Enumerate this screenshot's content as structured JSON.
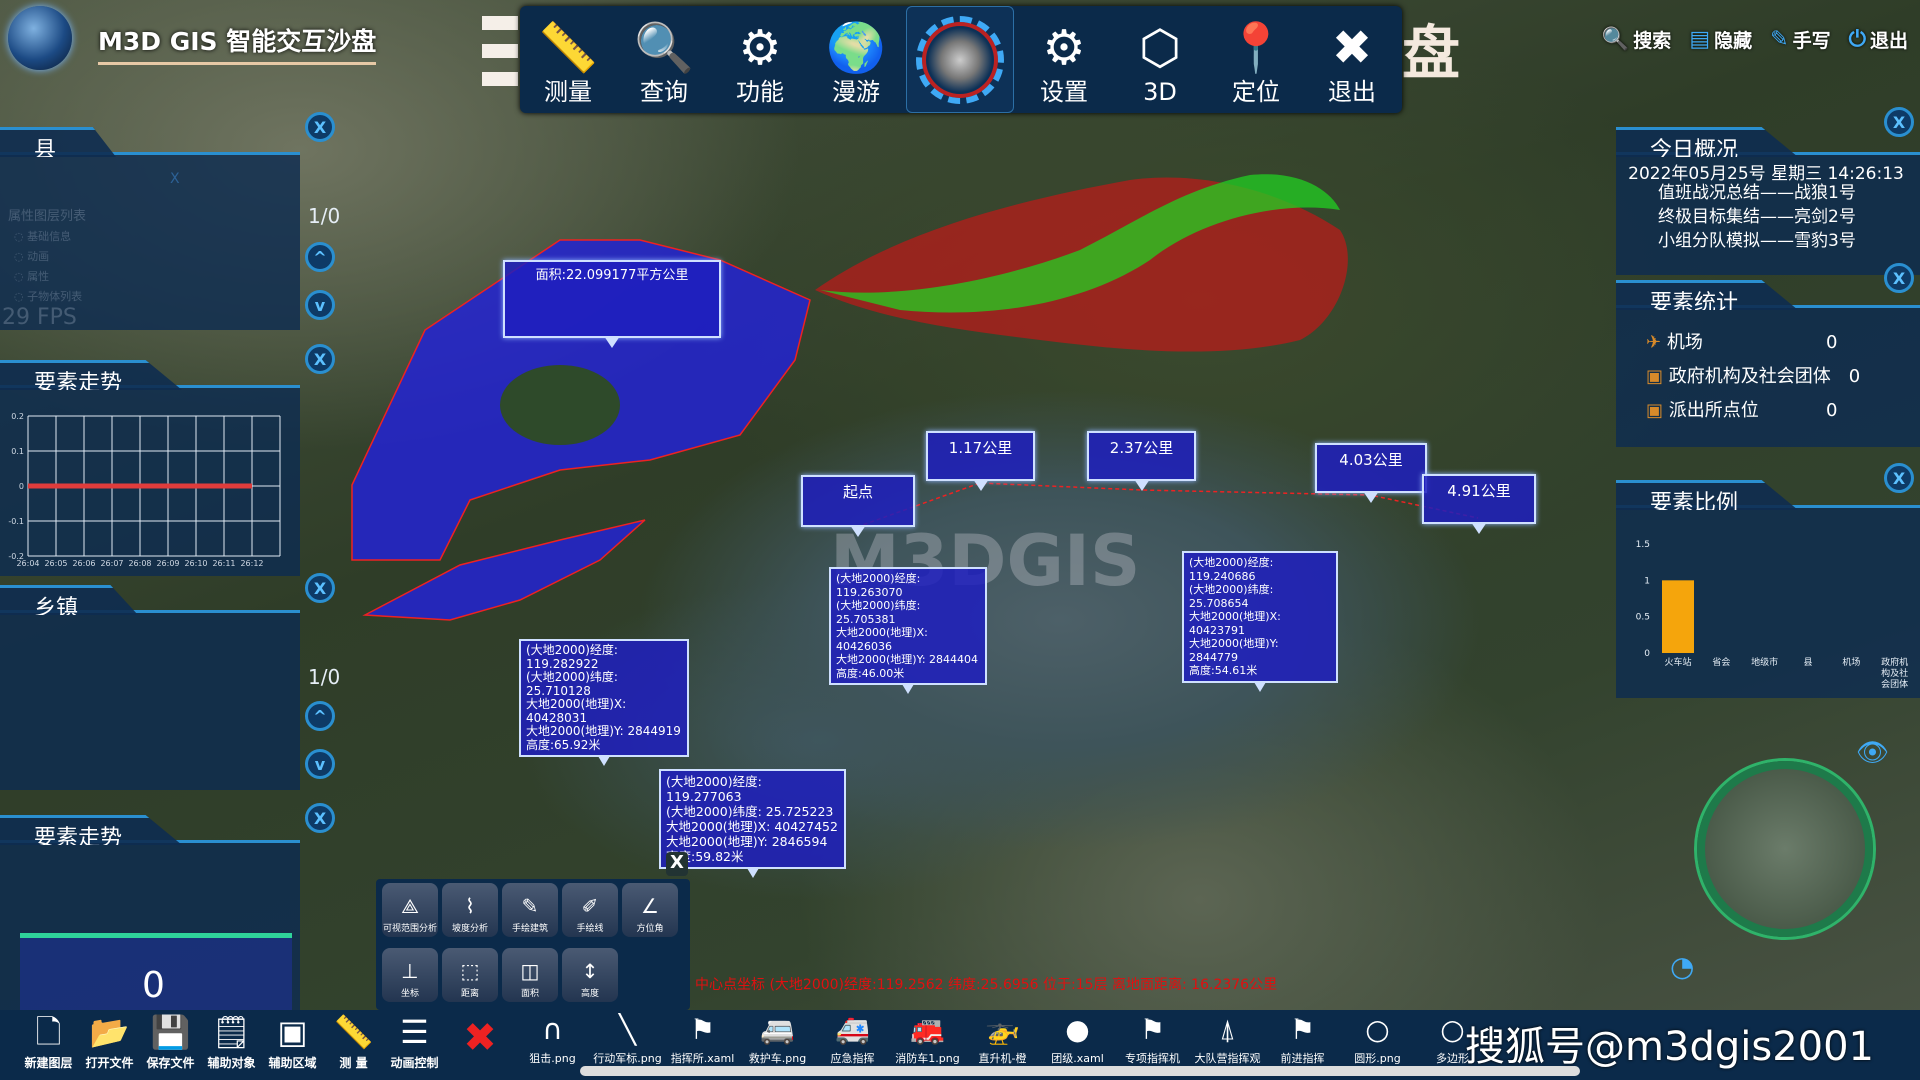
{
  "app": {
    "title": "M3D GIS 智能交互沙盘",
    "deco_char": "盘"
  },
  "toolbar": {
    "items": [
      {
        "label": "测量",
        "icon": "ruler-icon",
        "glyph": "📏"
      },
      {
        "label": "查询",
        "icon": "search-icon",
        "glyph": "🔍"
      },
      {
        "label": "功能",
        "icon": "gear-wrench-icon",
        "glyph": "⚙"
      },
      {
        "label": "漫游",
        "icon": "globe-pin-icon",
        "glyph": "🌍"
      }
    ],
    "items_right": [
      {
        "label": "设置",
        "icon": "settings-icon",
        "glyph": "⚙"
      },
      {
        "label": "3D",
        "icon": "cube-icon",
        "glyph": "⬡"
      },
      {
        "label": "定位",
        "icon": "location-pin-icon",
        "glyph": "📍"
      },
      {
        "label": "退出",
        "icon": "close-circle-icon",
        "glyph": "✖"
      }
    ]
  },
  "top_links": [
    {
      "label": "搜索",
      "glyph": "🔍"
    },
    {
      "label": "隐藏",
      "glyph": "▤"
    },
    {
      "label": "手写",
      "glyph": "✎"
    },
    {
      "label": "退出",
      "glyph": "⏻"
    }
  ],
  "left": {
    "county": {
      "title": "县",
      "close": "X",
      "pager": "1/0",
      "faded_title": "属性图层列表",
      "faded_items": [
        "基础信息",
        "动画",
        "属性",
        "子物体列表"
      ],
      "fps": "29 FPS",
      "inner_x": "X"
    },
    "trend1": {
      "title": "要素走势"
    },
    "town": {
      "title": "乡镇",
      "pager": "1/0"
    },
    "trend2": {
      "title": "要素走势",
      "value": "0"
    },
    "close": "X",
    "up": "^",
    "down": "v"
  },
  "right": {
    "today": {
      "title": "今日概况",
      "datetime": "2022年05月25号 星期三 14:26:13",
      "lines": [
        "值班战况总结——战狼1号",
        "终极目标集结——亮剑2号",
        "小组分队模拟——雪豹3号"
      ]
    },
    "stats": {
      "title": "要素统计",
      "rows": [
        {
          "name": "机场",
          "count": "0"
        },
        {
          "name": "政府机构及社会团体",
          "count": "0"
        },
        {
          "name": "派出所点位",
          "count": "0"
        }
      ]
    },
    "ratio": {
      "title": "要素比例"
    },
    "close": "X"
  },
  "chart_data": [
    {
      "type": "line",
      "title": "",
      "x": [
        "26:04",
        "26:05",
        "26:06",
        "26:07",
        "26:08",
        "26:09",
        "26:10",
        "26:11",
        "26:12"
      ],
      "series": [
        {
          "values": [
            0,
            0,
            0,
            0,
            0,
            0,
            0,
            0,
            0
          ],
          "color": "#e03c3c"
        }
      ],
      "ylim": [
        -0.2,
        0.2
      ],
      "yticks": [
        "0.2",
        "0.1",
        "0",
        "-0.1",
        "-0.2"
      ],
      "grid": true
    },
    {
      "type": "bar",
      "title": "",
      "categories": [
        "火车站",
        "省会",
        "地级市",
        "县",
        "机场",
        "政府机构及社会团体"
      ],
      "values": [
        1,
        0,
        0,
        0,
        0,
        0
      ],
      "ylim": [
        0,
        1.5
      ],
      "yticks": [
        "1.5",
        "1",
        "0.5",
        "0"
      ],
      "color": "#f5a50c"
    }
  ],
  "map": {
    "area_label": "面积:22.099177平方公里",
    "distance_labels": [
      "起点",
      "1.17公里",
      "2.37公里",
      "4.03公里",
      "4.91公里"
    ],
    "info_boxes": [
      [
        "(大地2000)经度: 119.263070",
        "(大地2000)纬度: 25.705381",
        "大地2000(地理)X: 40426036",
        "大地2000(地理)Y: 2844404",
        "高度:46.00米"
      ],
      [
        "(大地2000)经度: 119.240686",
        "(大地2000)纬度: 25.708654",
        "大地2000(地理)X: 40423791",
        "大地2000(地理)Y: 2844779",
        "高度:54.61米"
      ],
      [
        "(大地2000)经度: 119.282922",
        "(大地2000)纬度: 25.710128",
        "大地2000(地理)X: 40428031",
        "大地2000(地理)Y: 2844919",
        "高度:65.92米"
      ],
      [
        "(大地2000)经度: 119.277063",
        "(大地2000)纬度: 25.725223",
        "大地2000(地理)X: 40427452",
        "大地2000(地理)Y: 2846594",
        "高度:59.82米"
      ]
    ],
    "watermark": "M3DGIS",
    "status": "中心点坐标 (大地2000)经度:119.2562 纬度:25.6956 位于:15层 离地面距离: 16.2376公里",
    "polygon_color": "#2020d0"
  },
  "tools": {
    "close": "X",
    "items": [
      {
        "label": "可视范围分析",
        "glyph": "⟁"
      },
      {
        "label": "坡度分析",
        "glyph": "⌇"
      },
      {
        "label": "手绘建筑",
        "glyph": "✎"
      },
      {
        "label": "手绘线",
        "glyph": "✐"
      },
      {
        "label": "方位角",
        "glyph": "∠"
      },
      {
        "label": "坐标",
        "glyph": "⊥"
      },
      {
        "label": "距离",
        "glyph": "⬚"
      },
      {
        "label": "面积",
        "glyph": "◫"
      },
      {
        "label": "高度",
        "glyph": "↕"
      }
    ]
  },
  "bottom": {
    "main": [
      {
        "label": "新建图层",
        "glyph": "🗋"
      },
      {
        "label": "打开文件",
        "glyph": "📂"
      },
      {
        "label": "保存文件",
        "glyph": "💾"
      },
      {
        "label": "辅助对象",
        "glyph": "🗒"
      },
      {
        "label": "辅助区域",
        "glyph": "▣"
      },
      {
        "label": "测 量",
        "glyph": "📏"
      },
      {
        "label": "动画控制",
        "glyph": "☰"
      }
    ],
    "symbols": [
      {
        "label": "狙击.png",
        "glyph": "∩"
      },
      {
        "label": "行动军标.png",
        "glyph": "╲"
      },
      {
        "label": "指挥所.xaml",
        "glyph": "⚑"
      },
      {
        "label": "救护车.png",
        "glyph": "🚐"
      },
      {
        "label": "应急指挥",
        "glyph": "🚑"
      },
      {
        "label": "消防车1.png",
        "glyph": "🚒"
      },
      {
        "label": "直升机-橙",
        "glyph": "🚁"
      },
      {
        "label": "团级.xaml",
        "glyph": "●"
      },
      {
        "label": "专项指挥机",
        "glyph": "⚑"
      },
      {
        "label": "大队营指挥观",
        "glyph": "⍋"
      },
      {
        "label": "前进指挥",
        "glyph": "⚑"
      },
      {
        "label": "圆形.png",
        "glyph": "○"
      },
      {
        "label": "多边形",
        "glyph": "○"
      }
    ],
    "watermark": "搜狐号@m3dgis2001"
  }
}
